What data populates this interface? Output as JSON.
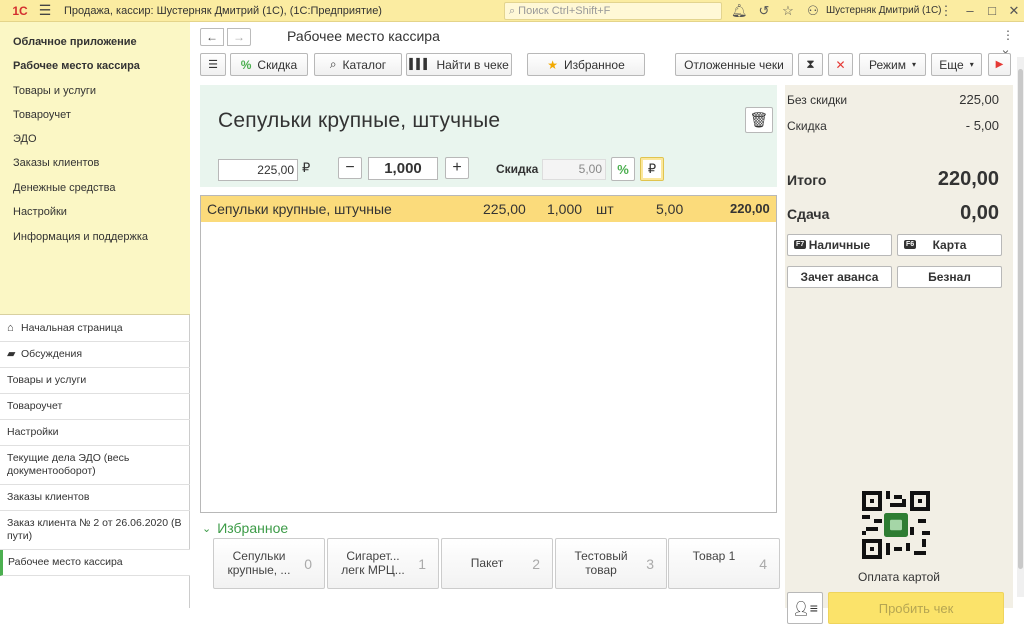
{
  "titlebar": {
    "logo": "1С",
    "title": "Продажа, кассир: Шустерняк Дмитрий (1С),  (1С:Предприятие)",
    "search_placeholder": "Поиск Ctrl+Shift+F",
    "user": "Шустерняк Дмитрий (1С)"
  },
  "sections": [
    {
      "label": "Облачное приложение",
      "bold": true
    },
    {
      "label": "Рабочее место кассира",
      "bold": true
    },
    {
      "label": "Товары и услуги"
    },
    {
      "label": "Товароучет"
    },
    {
      "label": "ЭДО"
    },
    {
      "label": "Заказы клиентов"
    },
    {
      "label": "Денежные средства"
    },
    {
      "label": "Настройки"
    },
    {
      "label": "Информация и поддержка"
    }
  ],
  "open_windows": [
    {
      "label": "Начальная страница",
      "icon": "home-icon"
    },
    {
      "label": "Обсуждения",
      "icon": "chat-icon"
    },
    {
      "label": "Товары и услуги"
    },
    {
      "label": "Товароучет"
    },
    {
      "label": "Настройки"
    },
    {
      "label": "Текущие дела ЭДО (весь документооборот)"
    },
    {
      "label": "Заказы клиентов"
    },
    {
      "label": "Заказ клиента № 2 от 26.06.2020 (В пути)"
    },
    {
      "label": "Рабочее место кассира",
      "active": true
    }
  ],
  "form": {
    "title": "Рабочее место кассира"
  },
  "toolbar": {
    "discount": "Скидка",
    "catalog": "Каталог",
    "find_in_receipt": "Найти в чеке",
    "favorites": "Избранное",
    "deferred": "Отложенные чеки",
    "mode": "Режим",
    "more": "Еще"
  },
  "current_item": {
    "name": "Сепульки крупные, штучные",
    "price": "225,00",
    "currency": "₽",
    "quantity": "1,000",
    "discount_label": "Скидка",
    "discount_value": "5,00"
  },
  "receipt_lines": [
    {
      "name": "Сепульки крупные, штучные",
      "price": "225,00",
      "qty": "1,000",
      "unit": "шт",
      "discount": "5,00",
      "sum": "220,00"
    }
  ],
  "favorites": {
    "header": "Избранное",
    "tiles": [
      {
        "label": "Сепульки крупные, ...",
        "num": "0"
      },
      {
        "label": "Сигарет... легк МРЦ...",
        "num": "1"
      },
      {
        "label": "Пакет",
        "num": "2"
      },
      {
        "label": "Тестовый товар",
        "num": "3"
      },
      {
        "label": "Товар 1",
        "num": "4"
      }
    ]
  },
  "totals": {
    "no_discount_label": "Без скидки",
    "no_discount": "225,00",
    "discount_label": "Скидка",
    "discount": "- 5,00",
    "total_label": "Итого",
    "total": "220,00",
    "change_label": "Сдача",
    "change": "0,00"
  },
  "payments": {
    "cash": "Наличные",
    "cash_key": "F7",
    "card": "Карта",
    "card_key": "F6",
    "advance": "Зачет аванса",
    "noncash": "Безнал"
  },
  "qr_label": "Оплата картой",
  "print_button": "Пробить чек"
}
